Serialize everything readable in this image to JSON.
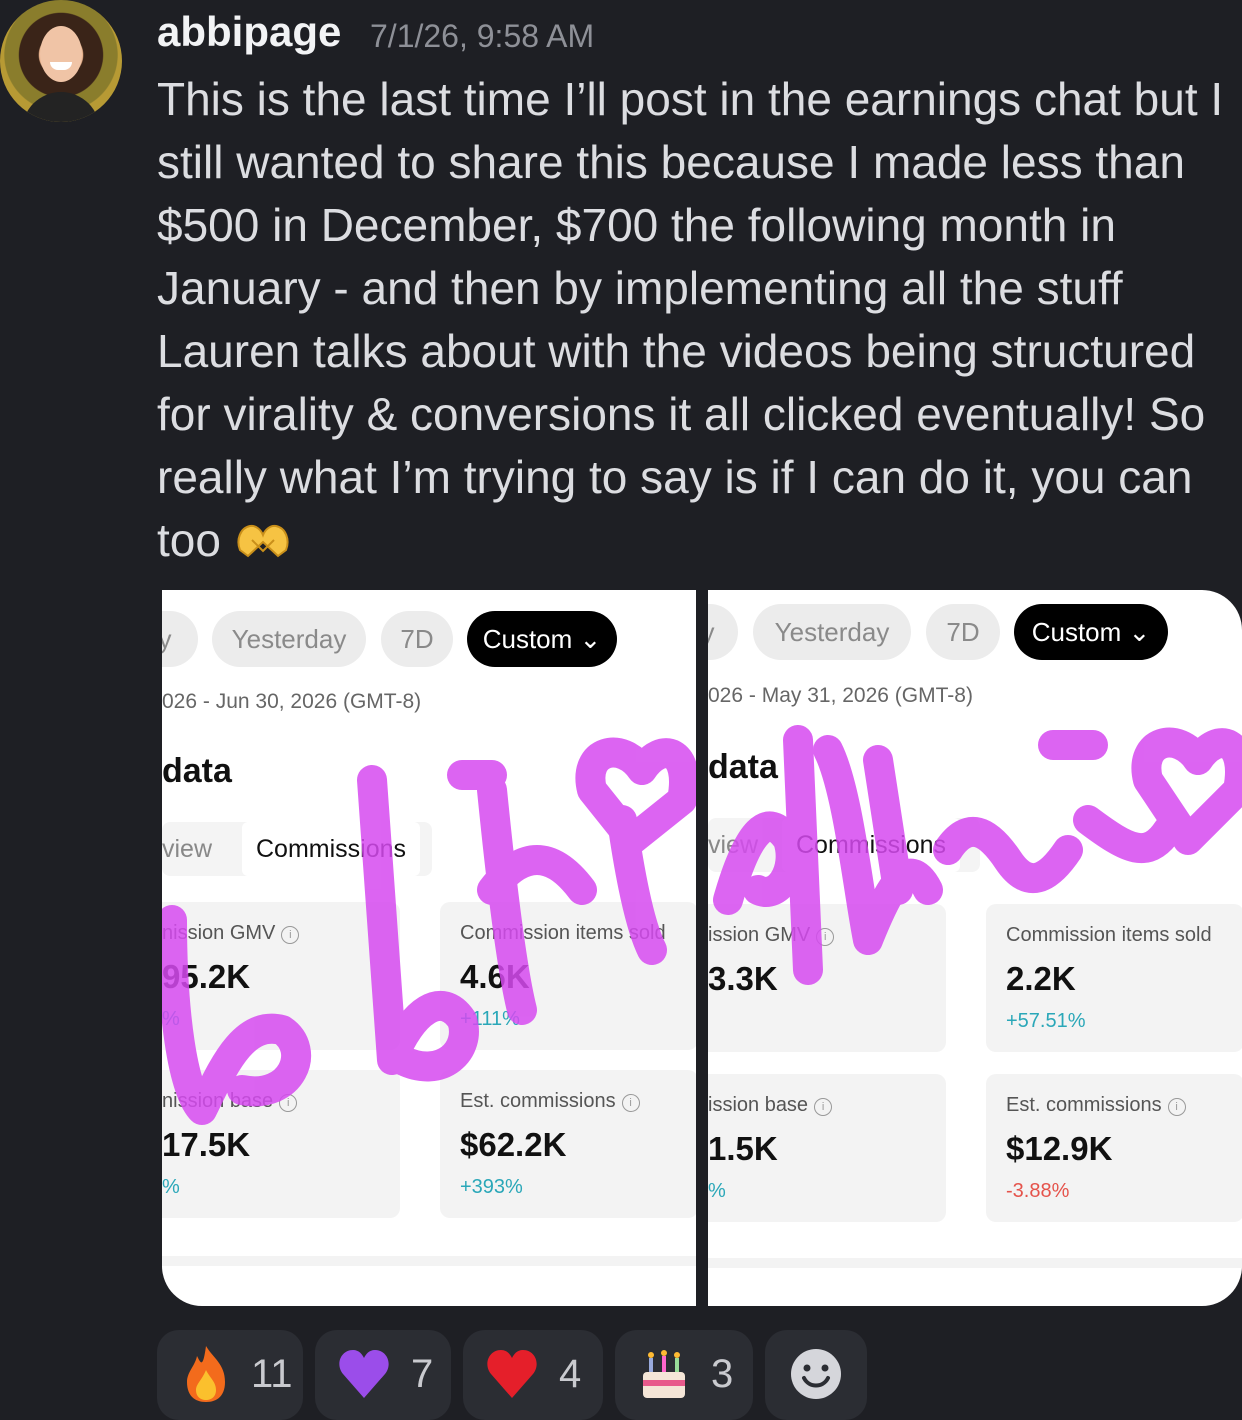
{
  "post": {
    "username": "abbipage",
    "timestamp": "7/1/26, 9:58 AM",
    "message": "This is the last time I’ll post in the earnings chat but I still wanted to share this because I made less than $500 in December, $700 the following month in January - and then by implementing all the stuff Lauren talks about with the videos being structured for virality & conversions it all clicked eventually! So really what I’m trying to say is if I can do it, you can too",
    "message_emoji": "heart-hands-icon"
  },
  "screenshot_left": {
    "tabs": [
      "y",
      "Yesterday",
      "7D",
      "Custom ⌄"
    ],
    "date_range": "026 - Jun 30, 2026 (GMT-8)",
    "heading": "data",
    "view_tabs": [
      "view",
      "Commissions"
    ],
    "cards": [
      {
        "label": "nission GMV",
        "value": "95.2K",
        "change": "%",
        "change_color": "#2aa7b8"
      },
      {
        "label": "Commission items sold",
        "value": "4.6K",
        "change": "+111%",
        "change_color": "#2aa7b8"
      },
      {
        "label": "nission base",
        "value": "17.5K",
        "change": "%",
        "change_color": "#2aa7b8"
      },
      {
        "label": "Est. commissions",
        "value": "$62.2K",
        "change": "+393%",
        "change_color": "#2aa7b8"
      }
    ]
  },
  "screenshot_right": {
    "tabs": [
      "y",
      "Yesterday",
      "7D",
      "Custom ⌄"
    ],
    "date_range": "026 - May 31, 2026 (GMT-8)",
    "heading": "data",
    "view_tabs": [
      "view",
      "Commissions"
    ],
    "cards": [
      {
        "label": "ission GMV",
        "value": "3.3K",
        "change": "",
        "change_color": "#2aa7b8"
      },
      {
        "label": "Commission items sold",
        "value": "2.2K",
        "change": "+57.51%",
        "change_color": "#2aa7b8"
      },
      {
        "label": "ission base",
        "value": "1.5K",
        "change": "%",
        "change_color": "#2aa7b8"
      },
      {
        "label": "Est. commissions",
        "value": "$12.9K",
        "change": "-3.88%",
        "change_color": "#e5534b"
      }
    ]
  },
  "reactions": [
    {
      "emoji": "fire-icon",
      "count": "11"
    },
    {
      "emoji": "purple-heart-icon",
      "count": "7"
    },
    {
      "emoji": "red-heart-icon",
      "count": "4"
    },
    {
      "emoji": "birthday-cake-icon",
      "count": "3"
    },
    {
      "emoji": "add-reaction-icon",
      "count": ""
    }
  ],
  "colors": {
    "background": "#1e1f24",
    "scribble": "#d64af0",
    "positive": "#2aa7b8",
    "negative": "#e5534b"
  }
}
